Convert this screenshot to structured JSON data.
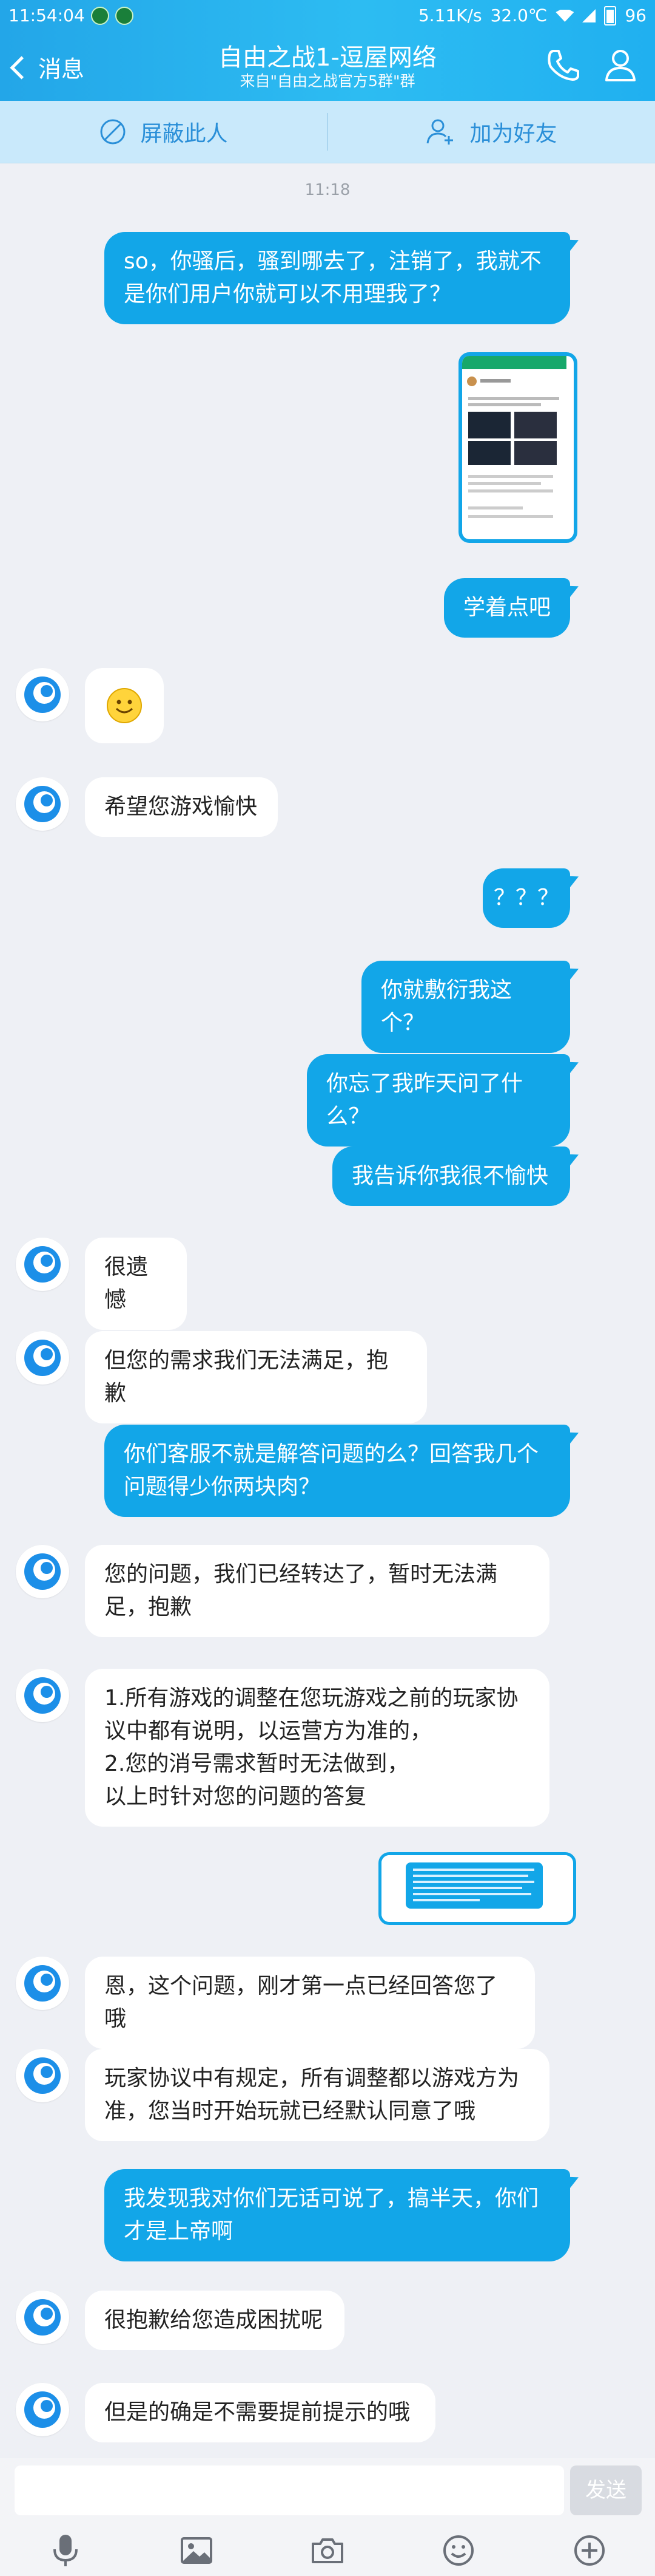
{
  "status_bar": {
    "time": "11:54:04",
    "network_speed": "5.11K/s",
    "temperature": "32.0℃",
    "battery": "96"
  },
  "header": {
    "back_label": "消息",
    "title": "自由之战1-逗屋网络",
    "subtitle": "来自\"自由之战官方5群\"群"
  },
  "actions": {
    "block_label": "屏蔽此人",
    "add_friend_label": "加为好友"
  },
  "chat": {
    "timestamp": "11:18",
    "messages": [
      {
        "from": "me",
        "text": "so，你骚后，骚到哪去了，注销了，我就不是你们用户你就可以不用理我了？"
      },
      {
        "from": "me",
        "type": "image"
      },
      {
        "from": "me",
        "text": "学着点吧"
      },
      {
        "from": "them",
        "type": "emoji",
        "text": "☺"
      },
      {
        "from": "them",
        "text": "希望您游戏愉快"
      },
      {
        "from": "me",
        "text": "？？？"
      },
      {
        "from": "me",
        "text": "你就敷衍我这个？"
      },
      {
        "from": "me",
        "text": "你忘了我昨天问了什么？"
      },
      {
        "from": "me",
        "text": "我告诉你我很不愉快"
      },
      {
        "from": "them",
        "text": "很遗憾"
      },
      {
        "from": "them",
        "text": "但您的需求我们无法满足，抱歉"
      },
      {
        "from": "me",
        "text": "你们客服不就是解答问题的么？回答我几个问题得少你两块肉？"
      },
      {
        "from": "them",
        "text": "您的问题，我们已经转达了，暂时无法满足，抱歉"
      },
      {
        "from": "them",
        "text": "1.所有游戏的调整在您玩游戏之前的玩家协议中都有说明，以运营方为准的，\n2.您的消号需求暂时无法做到，\n以上时针对您的问题的答复"
      },
      {
        "from": "me",
        "type": "image"
      },
      {
        "from": "them",
        "text": "恩，这个问题，刚才第一点已经回答您了哦"
      },
      {
        "from": "them",
        "text": "玩家协议中有规定，所有调整都以游戏方为准，您当时开始玩就已经默认同意了哦"
      },
      {
        "from": "me",
        "text": "我发现我对你们无话可说了，搞半天，你们才是上帝啊"
      },
      {
        "from": "them",
        "text": "很抱歉给您造成困扰呢"
      },
      {
        "from": "them",
        "text": "但是的确是不需要提前提示的哦"
      }
    ]
  },
  "input": {
    "placeholder": "",
    "send_label": "发送"
  },
  "colors": {
    "header_blue": "#23a6e8",
    "bubble_blue": "#12a6e8",
    "action_bar": "#c9e9fb",
    "background": "#eef0f5"
  }
}
